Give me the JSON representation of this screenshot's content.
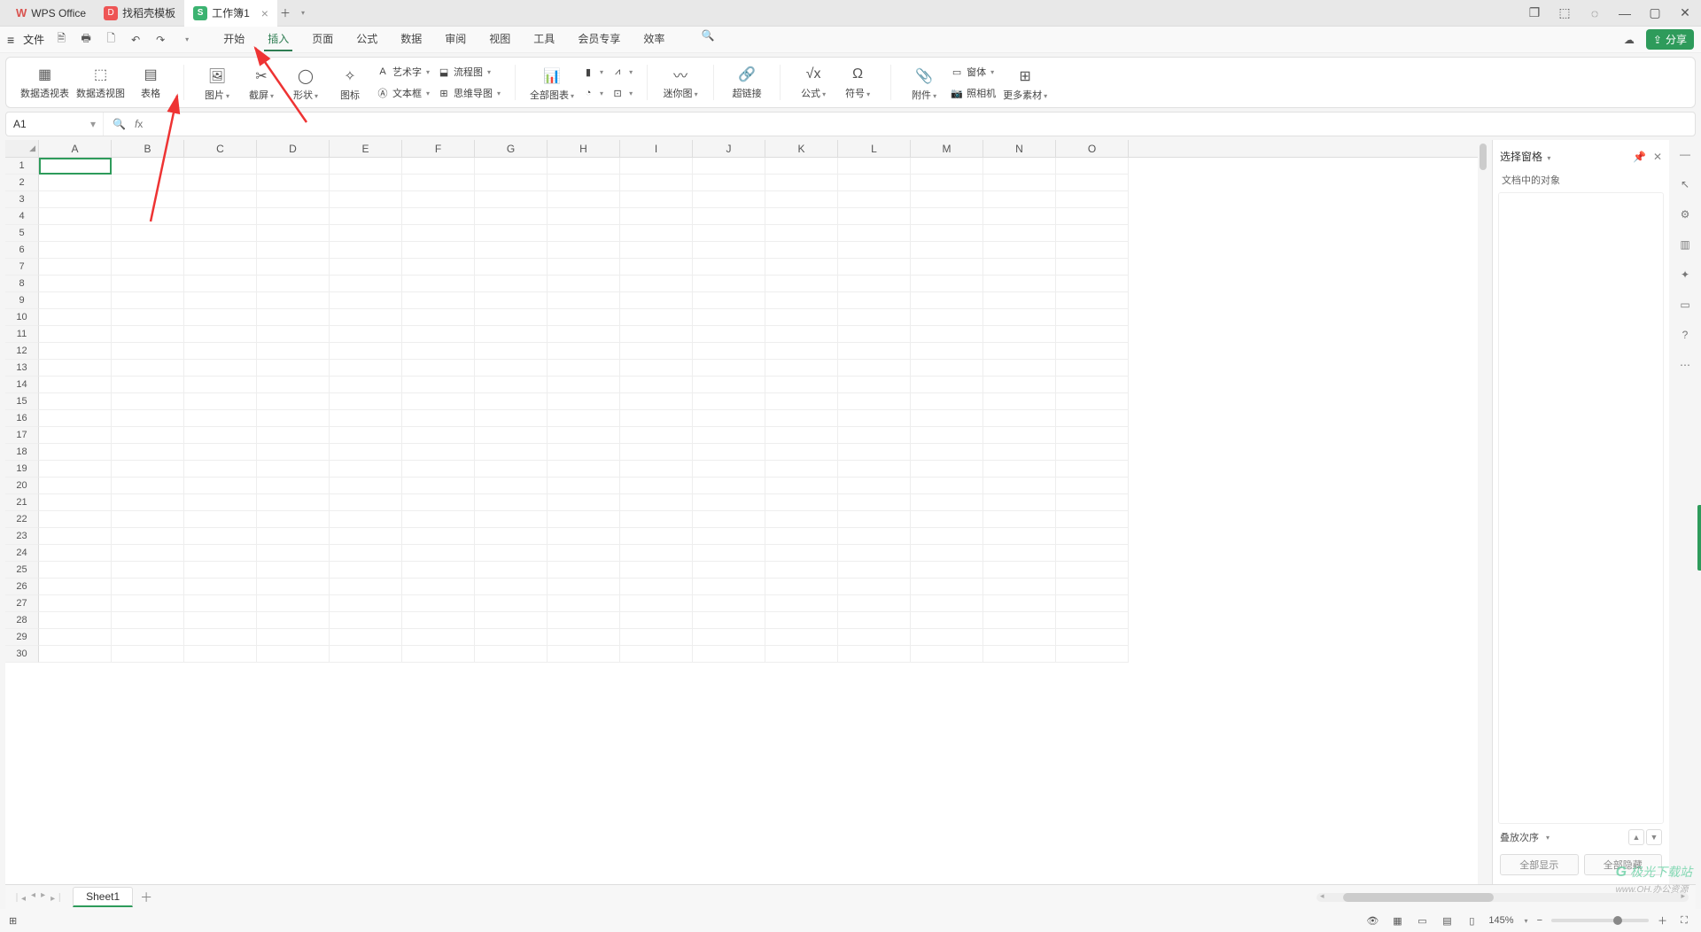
{
  "titlebar": {
    "app_name": "WPS Office",
    "tabs": [
      {
        "label": "找稻壳模板"
      },
      {
        "label": "工作簿1",
        "active": true
      }
    ]
  },
  "qat": {
    "file_label": "文件"
  },
  "menu": {
    "tabs": [
      "开始",
      "插入",
      "页面",
      "公式",
      "数据",
      "审阅",
      "视图",
      "工具",
      "会员专享",
      "效率"
    ],
    "active_index": 1
  },
  "share_label": "分享",
  "ribbon": {
    "g1": [
      {
        "id": "pivot-table",
        "label": "数据透视表"
      },
      {
        "id": "pivot-chart",
        "label": "数据透视图"
      },
      {
        "id": "table",
        "label": "表格"
      }
    ],
    "g2": [
      {
        "id": "picture",
        "label": "图片",
        "dd": true
      },
      {
        "id": "screenshot",
        "label": "截屏",
        "dd": true
      },
      {
        "id": "shapes",
        "label": "形状",
        "dd": true
      },
      {
        "id": "icons",
        "label": "图标"
      }
    ],
    "g2b": [
      {
        "id": "wordart",
        "label": "艺术字",
        "dd": true
      },
      {
        "id": "textbox",
        "label": "文本框",
        "dd": true
      },
      {
        "id": "flowchart",
        "label": "流程图",
        "dd": true
      },
      {
        "id": "mindmap",
        "label": "思维导图",
        "dd": true
      }
    ],
    "g3": [
      {
        "id": "all-charts",
        "label": "全部图表",
        "dd": true
      }
    ],
    "g4": [
      {
        "id": "sparkline",
        "label": "迷你图",
        "dd": true
      }
    ],
    "g5": [
      {
        "id": "hyperlink",
        "label": "超链接"
      }
    ],
    "g6": [
      {
        "id": "formula",
        "label": "公式",
        "dd": true
      },
      {
        "id": "symbol",
        "label": "符号",
        "dd": true
      }
    ],
    "g7": [
      {
        "id": "attachment",
        "label": "附件",
        "dd": true
      },
      {
        "id": "camera",
        "label": "照相机"
      },
      {
        "id": "more-assets",
        "label": "更多素材",
        "dd": true
      }
    ],
    "g7b": [
      {
        "id": "form-control",
        "label": "窗体",
        "dd": true
      }
    ]
  },
  "namebox": {
    "value": "A1"
  },
  "columns": [
    "A",
    "B",
    "C",
    "D",
    "E",
    "F",
    "G",
    "H",
    "I",
    "J",
    "K",
    "L",
    "M",
    "N",
    "O"
  ],
  "rows": 30,
  "active_cell": {
    "row": 1,
    "col": "A"
  },
  "sidepanel": {
    "title": "选择窗格",
    "subtitle": "文档中的对象",
    "order_label": "叠放次序",
    "show_all": "全部显示",
    "hide_all": "全部隐藏"
  },
  "sheet": {
    "name": "Sheet1"
  },
  "status": {
    "zoom": "145%"
  },
  "watermark": {
    "brand": "极光下载站",
    "sub": "www.OH.办公资源"
  }
}
